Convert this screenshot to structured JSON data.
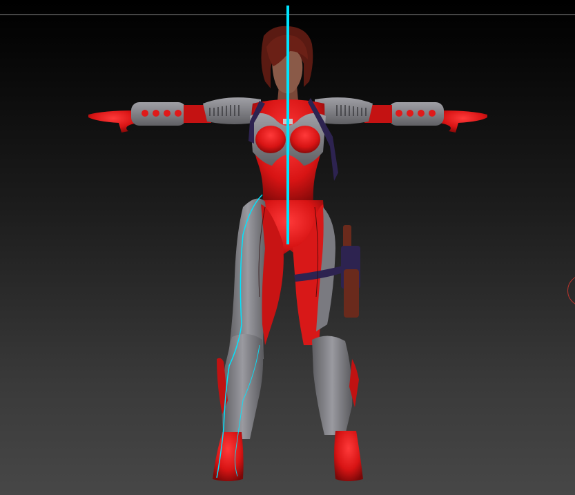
{
  "viewport": {
    "background_top": "#000000",
    "background_bottom": "#474747",
    "top_rule_color": "#8a8a8a"
  },
  "model": {
    "suit_color": "#e01a1a",
    "armor_color": "#8c8c90",
    "strap_color": "#2d2350",
    "hair_color": "#5a1a12",
    "skin_color": "#8a5a48",
    "holster_color": "#6a2a1c"
  },
  "symmetry_axis": {
    "color": "#00e5ff"
  },
  "edge_handle": {
    "icon": "circle-gizmo-icon",
    "color": "#b8342c"
  }
}
